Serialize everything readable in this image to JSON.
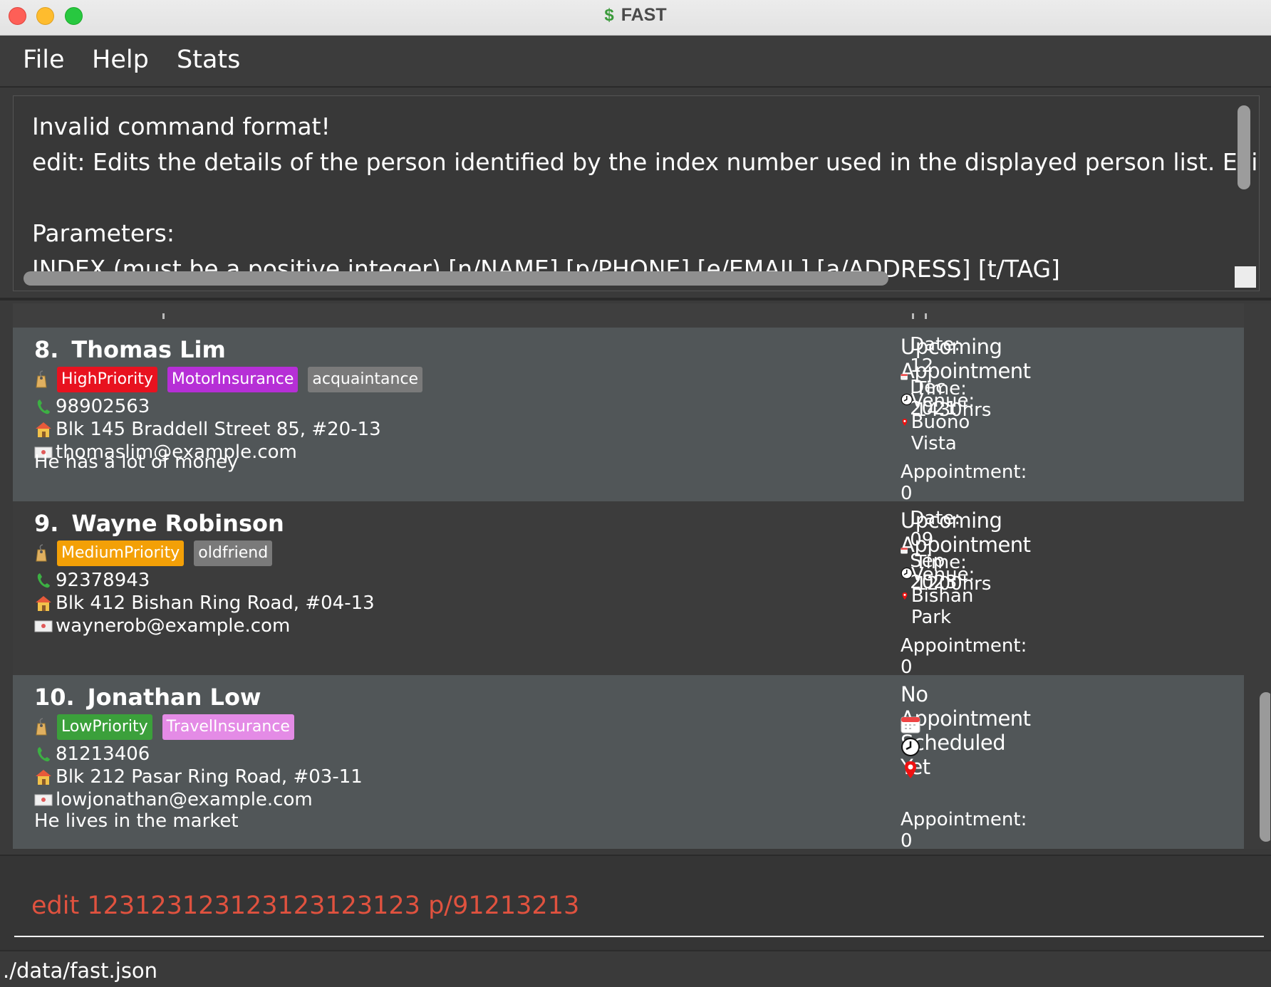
{
  "window": {
    "title": "FAST",
    "title_icon": "dollar-icon"
  },
  "menu": {
    "file": "File",
    "help": "Help",
    "stats": "Stats"
  },
  "result": {
    "text": "Invalid command format!\nedit: Edits the details of the person identified by the index number used in the displayed person list. Existing v\n\nParameters:\nINDEX (must be a positive integer) [n/NAME] [p/PHONE] [e/EMAIL] [a/ADDRESS] [t/TAG]"
  },
  "persons": [
    {
      "index": "8.",
      "name": "Thomas Lim",
      "tags": [
        {
          "label": "HighPriority",
          "color": "#e8121f"
        },
        {
          "label": "MotorInsurance",
          "color": "#b62fd6"
        },
        {
          "label": "acquaintance",
          "color": "#7a7a7a"
        }
      ],
      "phone": "98902563",
      "address": "Blk 145 Braddell Street 85, #20-13",
      "email": "thomaslim@example.com",
      "remark": "He has a lot of money",
      "appointment_header": "Upcoming Appointment",
      "date": "Date: 12 Dec 2021",
      "time": "Time: 1430hrs",
      "venue": "Venue: Buono Vista",
      "appointment_count": "Appointment: 0"
    },
    {
      "index": "9.",
      "name": "Wayne Robinson",
      "tags": [
        {
          "label": "MediumPriority",
          "color": "#f3a007"
        },
        {
          "label": "oldfriend",
          "color": "#7a7a7a"
        }
      ],
      "phone": "92378943",
      "address": "Blk 412 Bishan Ring Road, #04-13",
      "email": "waynerob@example.com",
      "remark": "",
      "appointment_header": "Upcoming Appointment",
      "date": "Date: 09 Sep 2023",
      "time": "Time: 1200hrs",
      "venue": "Venue: Bishan Park",
      "appointment_count": "Appointment: 0"
    },
    {
      "index": "10.",
      "name": "Jonathan Low",
      "tags": [
        {
          "label": "LowPriority",
          "color": "#3ba03b"
        },
        {
          "label": "TravelInsurance",
          "color": "#e48be6"
        }
      ],
      "phone": "81213406",
      "address": "Blk 212 Pasar Ring Road, #03-11",
      "email": "lowjonathan@example.com",
      "remark": "He lives in the market",
      "appointment_header": "No Appointment Scheduled Yet",
      "date": "",
      "time": "",
      "venue": "",
      "appointment_count": "Appointment: 0"
    }
  ],
  "command": {
    "value": "edit 123123123123123123123 p/91213213"
  },
  "status": {
    "path": "./data/fast.json"
  }
}
